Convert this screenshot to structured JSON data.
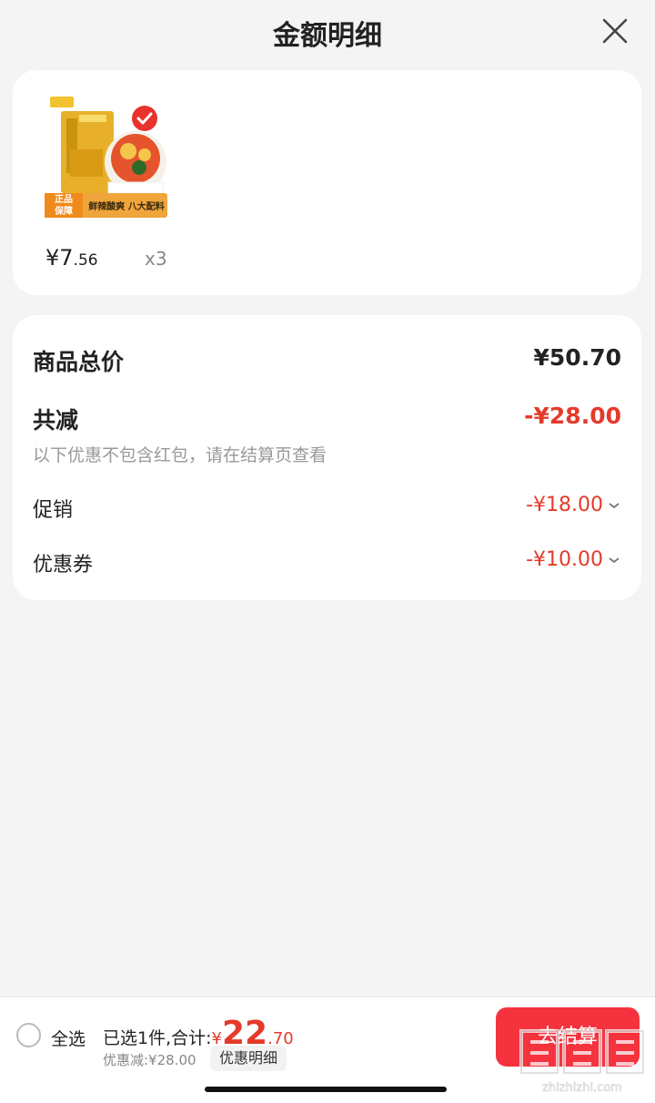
{
  "header": {
    "title": "金额明细"
  },
  "product": {
    "price_int": "¥7",
    "price_dec": ".56",
    "qty": "x3",
    "image_labels": {
      "badge": "正品保障",
      "tagline": "鲜辣酸爽 八大配料"
    }
  },
  "summary": {
    "total_label": "商品总价",
    "total_value": "¥50.70",
    "reduce_label": "共减",
    "reduce_value": "-¥28.00",
    "note": "以下优惠不包含红包，请在结算页查看",
    "promo_label": "促销",
    "promo_value": "-¥18.00",
    "coupon_label": "优惠券",
    "coupon_value": "-¥10.00"
  },
  "bottom": {
    "select_all": "全选",
    "selected_text": "已选1件,合计:",
    "yen": "¥",
    "total_int": "22",
    "total_dec": ".70",
    "discount_text": "优惠减:¥28.00",
    "detail_button": "优惠明细",
    "checkout": "去结算"
  },
  "colors": {
    "accent": "#e53a2a",
    "checkout_bg": "#f5333f",
    "page_bg": "#f4f4f4"
  }
}
